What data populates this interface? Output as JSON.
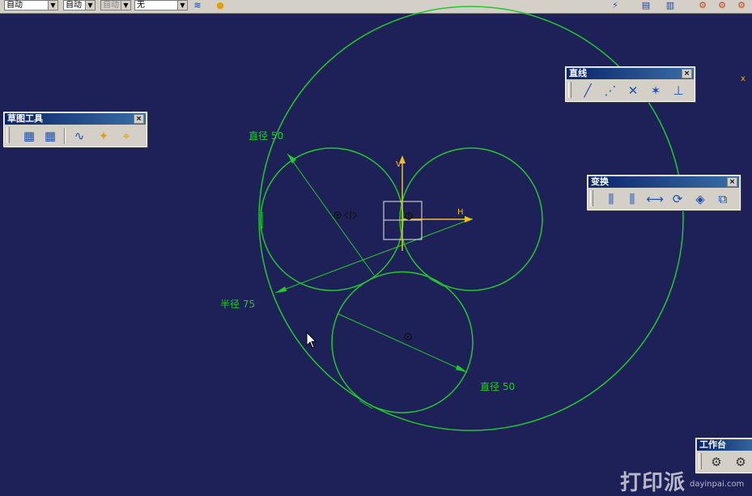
{
  "topbar": {
    "combo1": "自动",
    "combo2": "自动",
    "combo3": "自动",
    "combo4": "无"
  },
  "toolbars": {
    "sketch_tools": {
      "title": "草图工具",
      "close": "×"
    },
    "line": {
      "title": "直线",
      "close": "×"
    },
    "transform": {
      "title": "变换",
      "close": "×"
    },
    "workbench": {
      "title": "工作台"
    }
  },
  "sketch": {
    "axis_h_label": "H",
    "axis_v_label": "V",
    "dim_diameter_1": "直径 50",
    "dim_radius": "半径 75",
    "dim_diameter_2": "直径 50"
  },
  "misc": {
    "corner_mark": "x",
    "watermark": "打印派",
    "watermark_url": "dayinpai.com"
  },
  "colors": {
    "background": "#1e2058",
    "geometry": "#22c92a",
    "axis": "#f0c020",
    "toolbar": "#d4d0c8"
  }
}
